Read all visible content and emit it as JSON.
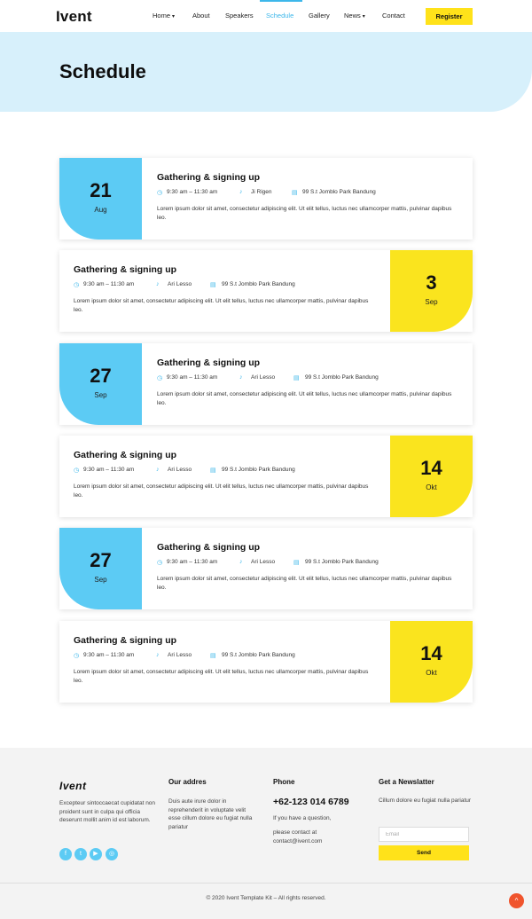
{
  "header": {
    "logo": "Ivent",
    "nav": [
      {
        "label": "Home",
        "dropdown": true
      },
      {
        "label": "About",
        "dropdown": false
      },
      {
        "label": "Speakers",
        "dropdown": false
      },
      {
        "label": "Schedule",
        "dropdown": false,
        "active": true
      },
      {
        "label": "Gallery",
        "dropdown": false
      },
      {
        "label": "News",
        "dropdown": true
      },
      {
        "label": "Contact",
        "dropdown": false
      }
    ],
    "register_label": "Register"
  },
  "hero": {
    "title": "Schedule"
  },
  "schedule": [
    {
      "day": "21",
      "month": "Aug",
      "title": "Gathering & signing up",
      "time": "9:30 am – 11:30 am",
      "speaker": "Ji Rigen",
      "location": "99 S.t Jomblo Park Bandung",
      "description": "Lorem ipsum dolor sit amet, consectetur adipiscing elit. Ut elit tellus, luctus nec ullamcorper mattis, pulvinar dapibus leo."
    },
    {
      "day": "3",
      "month": "Sep",
      "title": "Gathering & signing up",
      "time": "9:30 am – 11:30 am",
      "speaker": "Ari Lesso",
      "location": "99 S.t Jomblo Park Bandung",
      "description": "Lorem ipsum dolor sit amet, consectetur adipiscing elit. Ut elit tellus, luctus nec ullamcorper mattis, pulvinar dapibus leo."
    },
    {
      "day": "27",
      "month": "Sep",
      "title": "Gathering & signing up",
      "time": "9:30 am – 11:30 am",
      "speaker": "Ari Lesso",
      "location": "99 S.t Jomblo Park Bandung",
      "description": "Lorem ipsum dolor sit amet, consectetur adipiscing elit. Ut elit tellus, luctus nec ullamcorper mattis, pulvinar dapibus leo."
    },
    {
      "day": "14",
      "month": "Okt",
      "title": "Gathering & signing up",
      "time": "9:30 am – 11:30 am",
      "speaker": "Ari Lesso",
      "location": "99 S.t Jomblo Park Bandung",
      "description": "Lorem ipsum dolor sit amet, consectetur adipiscing elit. Ut elit tellus, luctus nec ullamcorper mattis, pulvinar dapibus leo."
    },
    {
      "day": "27",
      "month": "Sep",
      "title": "Gathering & signing up",
      "time": "9:30 am – 11:30 am",
      "speaker": "Ari Lesso",
      "location": "99 S.t Jomblo Park Bandung",
      "description": "Lorem ipsum dolor sit amet, consectetur adipiscing elit. Ut elit tellus, luctus nec ullamcorper mattis, pulvinar dapibus leo."
    },
    {
      "day": "14",
      "month": "Okt",
      "title": "Gathering & signing up",
      "time": "9:30 am – 11:30 am",
      "speaker": "Ari Lesso",
      "location": "99 S.t Jomblo Park Bandung",
      "description": "Lorem ipsum dolor sit amet, consectetur adipiscing elit. Ut elit tellus, luctus nec ullamcorper mattis, pulvinar dapibus leo."
    }
  ],
  "footer": {
    "logo": "Ivent",
    "about": "Excepteur sintoccaecat cupidatat non proident sunt in culpa qui officia deserunt mollit anim id est laborum.",
    "socials": [
      {
        "icon": "facebook-icon",
        "glyph": "f"
      },
      {
        "icon": "twitter-icon",
        "glyph": "t"
      },
      {
        "icon": "youtube-icon",
        "glyph": "▶"
      },
      {
        "icon": "instagram-icon",
        "glyph": "◎"
      }
    ],
    "address_heading": "Our addres",
    "address_text": "Duis aute irure dolor in reprehenderit in voluptate velit esse cillum dolore eu fugiat nulla pariatur",
    "phone_heading": "Phone",
    "phone_number": "+62-123 014 6789",
    "phone_question": "If you have a question,",
    "phone_contact": "please contact at contact@ivent.com",
    "newsletter_heading": "Get a Newslatter",
    "newsletter_text": "Cillum dolore eu fugiat nulla pariatur",
    "email_placeholder": "Email",
    "send_label": "Send",
    "copyright": "© 2020 Ivent Template Kit – All rights reserved.",
    "to_top_glyph": "^"
  },
  "colors": {
    "accent_blue": "#5ccbf4",
    "accent_yellow": "#fae41e",
    "hero_bg": "#d7f0fb",
    "to_top": "#f0542d"
  }
}
